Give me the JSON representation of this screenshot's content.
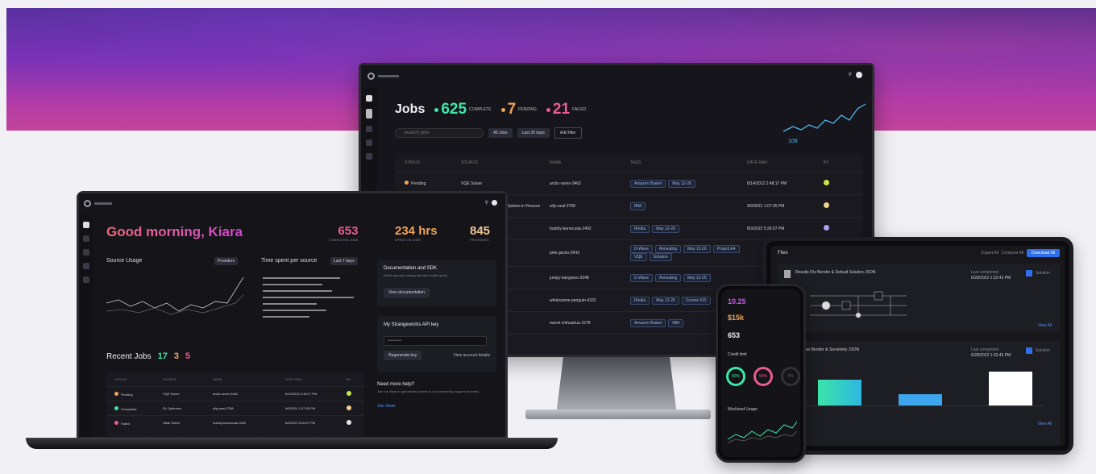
{
  "colors": {
    "accent_pink": "#e85c8e",
    "accent_orange": "#f0a45a",
    "accent_green": "#3ee6a8",
    "accent_purple": "#c25ce2",
    "link_blue": "#3b7bf2"
  },
  "monitor": {
    "title": "Jobs",
    "complete_count": "625",
    "complete_label": "COMPLETE",
    "pending_count": "7",
    "pending_label": "PENDING",
    "failed_count": "21",
    "failed_label": "FAILED",
    "search_placeholder": "Search jobs",
    "filters": [
      "All Jobs",
      "Last 30 days",
      "Add filter"
    ],
    "spark_value": "108",
    "table_headers": [
      "STATUS",
      "SOURCE",
      "NAME",
      "TAGS",
      "DATE RAN",
      "BY"
    ],
    "rows": [
      {
        "status": "Pending",
        "source": "VQE Solver",
        "name": "arctic-raven-3462",
        "tags": [
          "Amazon Braket",
          "May 12-26"
        ],
        "date": "8/14/2022 2:48:17 PM"
      },
      {
        "status": "",
        "source": "Stochastic Processes for Options in Finance",
        "name": "silly-seal-2768",
        "tags": [
          "IBM"
        ],
        "date": "9/9/2021 1:07:05 PM"
      },
      {
        "status": "",
        "source": "",
        "name": "bubbly-barracuda-3492",
        "tags": [
          "Rindia",
          "May 12-26"
        ],
        "date": "8/3/2022 5:26:07 PM"
      },
      {
        "status": "",
        "source": "",
        "name": "pink-gecko-2643",
        "tags": [
          "D-Wave",
          "Annealing",
          "May 12-26",
          "Project A4",
          "VQE",
          "Solution"
        ],
        "date": ""
      },
      {
        "status": "",
        "source": "",
        "name": "jumpy-kangaroo-3348",
        "tags": [
          "D-Wave",
          "Annealing",
          "May 12-26"
        ],
        "date": ""
      },
      {
        "status": "",
        "source": "",
        "name": "wholesome-penguin-4333",
        "tags": [
          "Rindia",
          "May 12-26",
          "Course #15"
        ],
        "date": ""
      },
      {
        "status": "",
        "source": "",
        "name": "sweet-chihuahua-2278",
        "tags": [
          "Amazon Braket",
          "IBM"
        ],
        "date": ""
      }
    ]
  },
  "laptop": {
    "greeting": "Good morning, Kiara",
    "stats": [
      {
        "value": "653",
        "label": "COMPLETED JOBS"
      },
      {
        "value": "234 hrs",
        "label": "SPENT ON JOBS"
      },
      {
        "value": "845",
        "label": "PROVIDERS"
      }
    ],
    "source_usage": "Source Usage",
    "providers_btn": "Providers",
    "time_title": "Time spent per source",
    "time_range": "Last 7 days",
    "doc_title": "Documentation and SDK",
    "doc_text": "Hit the ground running with this helpful guide.",
    "doc_btn": "View documentation",
    "api_title": "My Strangeworks API key",
    "api_placeholder": "••••••••••",
    "regen_btn": "Regenerate key",
    "account_link": "View account details",
    "help_title": "Need more help?",
    "help_text": "Join our Slack to get instant access to our community support channels.",
    "slack_link": "Join Slack",
    "recent_title": "Recent Jobs",
    "recent_complete": "17",
    "recent_pending": "3",
    "recent_failed": "5",
    "recent_headers": [
      "STATUS",
      "SOURCE",
      "NAME",
      "DATE RAN",
      "BY"
    ],
    "recent_rows": [
      {
        "status": "Pending",
        "source": "VQE Solver",
        "name": "arctic-raven-3462",
        "date": "8/14/2022 2:48:17 PM"
      },
      {
        "status": "Completed",
        "source": "RL Optimizer",
        "name": "silly-seal-2768",
        "date": "9/9/2021 1:07:05 PM"
      },
      {
        "status": "Failed",
        "source": "Slate Solver",
        "name": "bubbly-barracuda-3492",
        "date": "8/3/2022 5:26:07 PM"
      }
    ]
  },
  "phone": {
    "value1": "10.25",
    "value2": "$15k",
    "value3": "653",
    "label": "Credit limit",
    "gauges": [
      "60%",
      "50%",
      "0%"
    ],
    "chart_title": "Workload Usage"
  },
  "tablet": {
    "header": "Files",
    "btn1": "Export All",
    "btn2": "Compare All",
    "primary_btn": "Download All",
    "item1_title": "Results Filz Bender & Default Solution JSON",
    "item1_label": "Last completed",
    "item1_date": "6/28/2022 1:32:43 PM",
    "item1_badge": "Solution",
    "item2_title": "Filz Two Bender & Sensitivity JSON",
    "item2_label": "Last completed",
    "item2_date": "6/28/2022 1:32:43 PM",
    "item2_badge": "Solution",
    "view_all": "View All"
  }
}
